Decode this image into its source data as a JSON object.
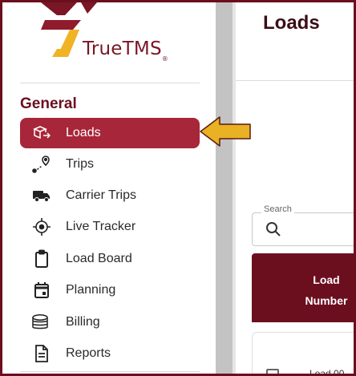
{
  "brand": {
    "name": "TrueTMS",
    "trademark": "®"
  },
  "sidebar": {
    "section_title": "General",
    "items": [
      {
        "label": "Loads",
        "icon": "box-arrow-icon",
        "active": true
      },
      {
        "label": "Trips",
        "icon": "route-pin-icon",
        "active": false
      },
      {
        "label": "Carrier Trips",
        "icon": "truck-icon",
        "active": false
      },
      {
        "label": "Live Tracker",
        "icon": "crosshair-icon",
        "active": false
      },
      {
        "label": "Load Board",
        "icon": "clipboard-icon",
        "active": false
      },
      {
        "label": "Planning",
        "icon": "calendar-icon",
        "active": false
      },
      {
        "label": "Billing",
        "icon": "coins-icon",
        "active": false
      },
      {
        "label": "Reports",
        "icon": "document-icon",
        "active": false
      }
    ]
  },
  "main": {
    "title": "Loads",
    "search": {
      "label": "Search"
    },
    "table": {
      "columns": [
        "Load Number"
      ],
      "row_preview": "Load 00"
    }
  },
  "colors": {
    "accent_dark": "#6b0f1f",
    "accent_active": "#a8263a",
    "logo_gold": "#f0b323",
    "callout_gold": "#e9b124"
  }
}
